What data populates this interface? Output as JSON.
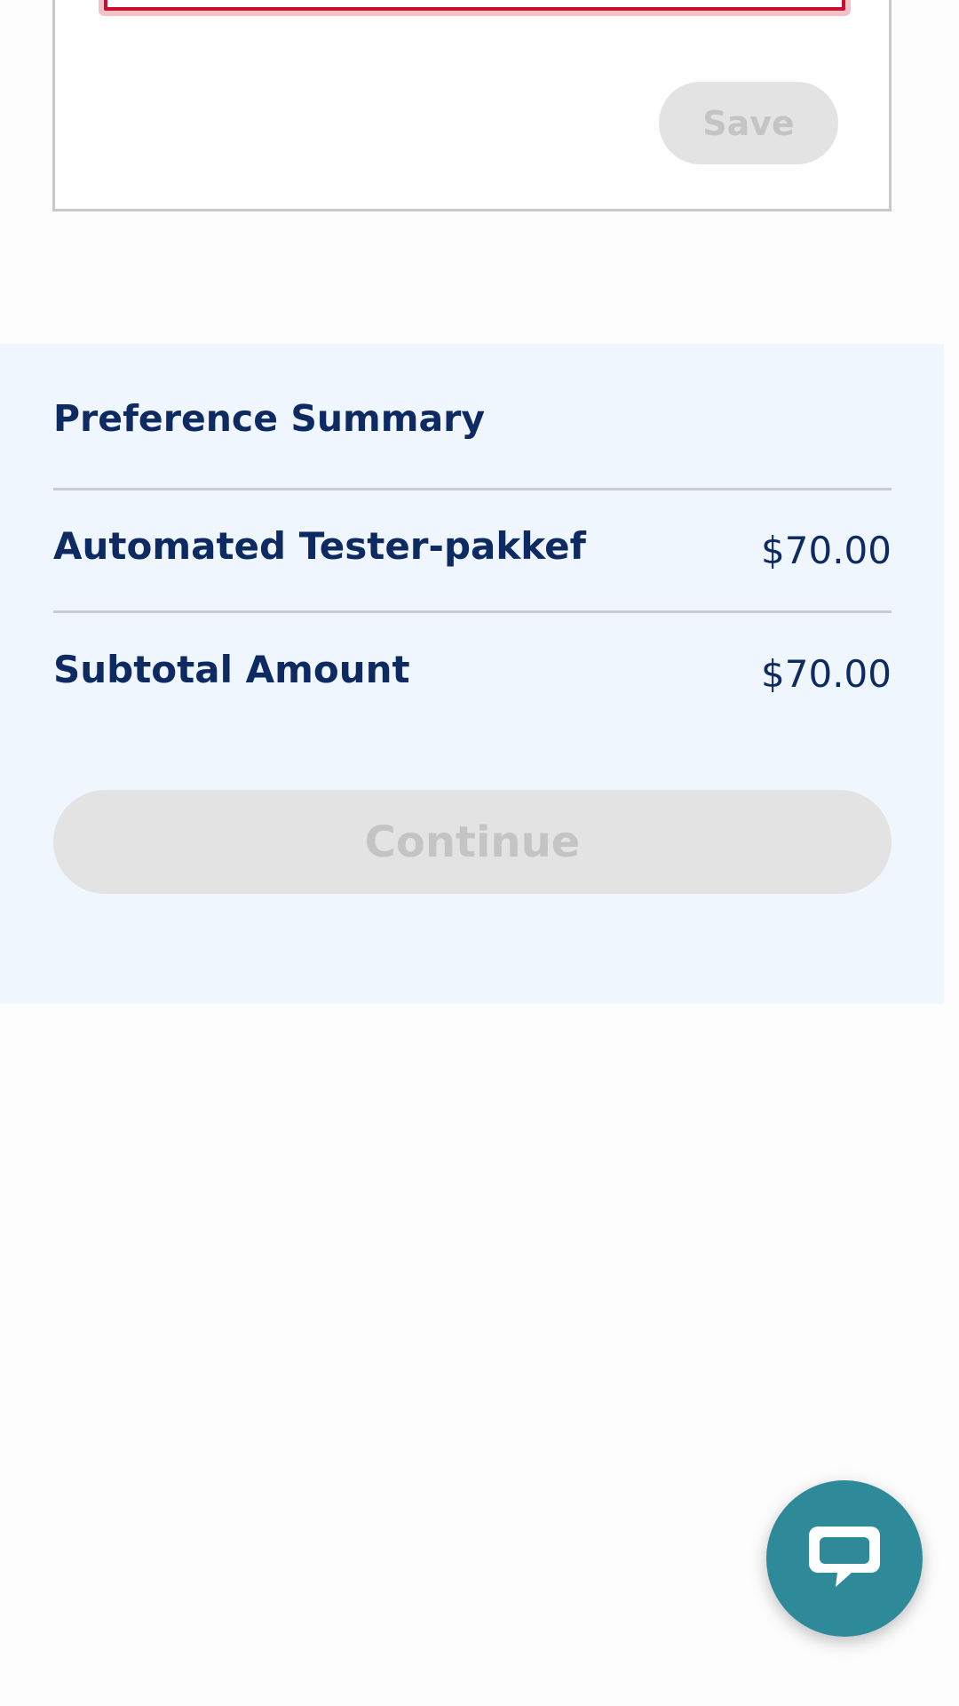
{
  "form": {
    "save_label": "Save"
  },
  "summary": {
    "title": "Preference Summary",
    "item": {
      "label": "Automated Tester-pakkef",
      "price": "$70.00"
    },
    "subtotal": {
      "label": "Subtotal Amount",
      "price": "$70.00"
    },
    "continue_label": "Continue"
  },
  "chat": {
    "icon": "chat-bubble-icon"
  },
  "colors": {
    "navy_text": "#0d2a62",
    "summary_bg": "#eff6fd",
    "disabled_button_bg": "#e3e3e3",
    "disabled_button_text": "#c4c4c4",
    "error_border": "#c8102e",
    "chat_fab": "#2e8a99"
  }
}
